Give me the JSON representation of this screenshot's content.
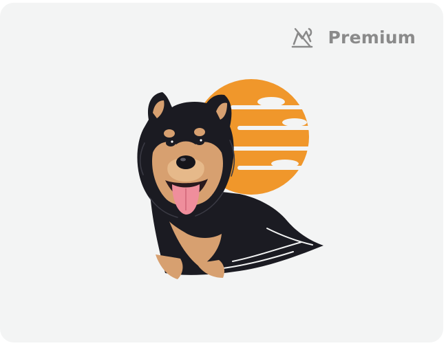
{
  "badge": {
    "label": "Premium",
    "icon": "premium-crown-icon"
  },
  "illustration": {
    "subject": "dog-portrait-illustration",
    "sun_color": "#f0972b",
    "fur_dark": "#1b1b22",
    "fur_tan": "#d7a070",
    "tongue_color": "#ef8e9c"
  },
  "colors": {
    "card_background": "#f3f4f4",
    "badge_text": "#8a8a8a"
  }
}
